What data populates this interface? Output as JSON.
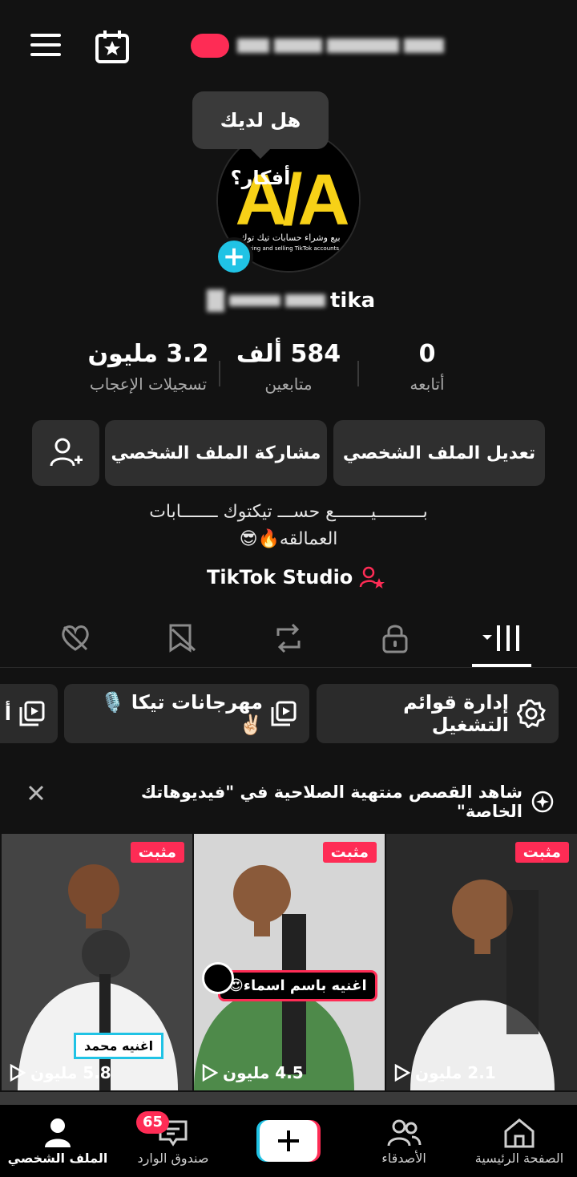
{
  "header": {
    "menu_icon": "hamburger-icon",
    "calendar_icon": "calendar-star-icon"
  },
  "tooltip": {
    "text": "هل لديك أفكار؟"
  },
  "avatar": {
    "logo_text": "A/A",
    "logo_caption_ar": "بيع وشراء حسابات تيك توك",
    "logo_caption_en": "Buying and selling TikTok accounts"
  },
  "profile": {
    "username_suffix": "tika"
  },
  "stats": {
    "likes": {
      "value": "3.2 مليون",
      "label": "تسجيلات الإعجاب"
    },
    "followers": {
      "value": "584 ألف",
      "label": "متابعين"
    },
    "following": {
      "value": "0",
      "label": "أتابعه"
    }
  },
  "actions": {
    "edit": "تعديل الملف الشخصي",
    "share": "مشاركة الملف الشخصي",
    "add_friend_icon": "add-user-icon"
  },
  "bio": {
    "line1": "بـــــــــيـــــــع حســـ تيكتوك ـــــــابات",
    "line2": "العمالقه🔥😎"
  },
  "studio": {
    "label": "TikTok Studio"
  },
  "tabs": [
    "videos-grid",
    "private",
    "reposts",
    "favorites",
    "liked"
  ],
  "chips": {
    "manage": "إدارة قوائم التشغيل",
    "playlist1": "مهرجانات تيكا 🎙️✌🏻",
    "playlist2": "أ"
  },
  "notice": {
    "text": "شاهد القصص منتهية الصلاحية في \"فيديوهاتك الخاصة\""
  },
  "videos": [
    {
      "pinned": "مثبت",
      "views": "2.1 مليون",
      "bg": "#2a2a2a",
      "shirt": "#eeeeee",
      "caption": ""
    },
    {
      "pinned": "مثبت",
      "views": "4.5 مليون",
      "bg": "#d6d6d6",
      "shirt": "#4e8a4a",
      "caption": "اغنيه باسم اسماء😍"
    },
    {
      "pinned": "مثبت",
      "views": "5.8 مليون",
      "bg": "#444444",
      "shirt": "#f2f2f2",
      "caption": "اغنيه محمد"
    }
  ],
  "nav": {
    "home": "الصفحة الرئيسية",
    "friends": "الأصدقاء",
    "inbox": "صندوق الوارد",
    "inbox_badge": "65",
    "profile": "الملف الشخصي"
  },
  "colors": {
    "accent": "#fe2c55",
    "cyan": "#20c3e5",
    "bg": "#121212"
  }
}
